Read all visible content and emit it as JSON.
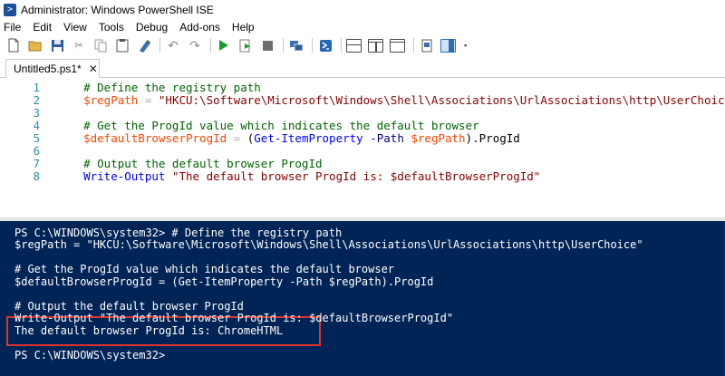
{
  "window": {
    "title": "Administrator: Windows PowerShell ISE"
  },
  "menu": [
    "File",
    "Edit",
    "View",
    "Tools",
    "Debug",
    "Add-ons",
    "Help"
  ],
  "toolbar": {
    "icons": [
      "new-icon",
      "open-icon",
      "save-icon",
      "cut-icon",
      "copy-icon",
      "paste-icon",
      "clear-console-icon",
      "undo-icon",
      "redo-icon",
      "run-icon",
      "run-selection-icon",
      "stop-icon",
      "new-remote-tab-icon",
      "powershell-icon",
      "show-script-top-icon",
      "show-script-right-icon",
      "show-script-maximized-icon",
      "show-command-icon",
      "show-command-addon-icon"
    ]
  },
  "tabs": [
    {
      "label": "Untitled5.ps1*",
      "close": "✕"
    }
  ],
  "editor": {
    "lines": [
      {
        "num": "1",
        "parts": [
          {
            "t": "    # Define the registry path",
            "c": "comment"
          }
        ]
      },
      {
        "num": "2",
        "parts": [
          {
            "t": "    $regPath",
            "c": "var"
          },
          {
            "t": " = ",
            "c": "op"
          },
          {
            "t": "\"HKCU:\\Software\\Microsoft\\Windows\\Shell\\Associations\\UrlAssociations\\http\\UserChoice\"",
            "c": "str"
          }
        ]
      },
      {
        "num": "3",
        "parts": [
          {
            "t": "",
            "c": "plain"
          }
        ]
      },
      {
        "num": "4",
        "parts": [
          {
            "t": "    # Get the ProgId value which indicates the default browser",
            "c": "comment"
          }
        ]
      },
      {
        "num": "5",
        "parts": [
          {
            "t": "    $defaultBrowserProgId",
            "c": "var"
          },
          {
            "t": " = ",
            "c": "op"
          },
          {
            "t": "(",
            "c": "plain"
          },
          {
            "t": "Get-ItemProperty",
            "c": "cmd"
          },
          {
            "t": " -Path ",
            "c": "param"
          },
          {
            "t": "$regPath",
            "c": "var"
          },
          {
            "t": ").ProgId",
            "c": "plain"
          }
        ]
      },
      {
        "num": "6",
        "parts": [
          {
            "t": "",
            "c": "plain"
          }
        ]
      },
      {
        "num": "7",
        "parts": [
          {
            "t": "    # Output the default browser ProgId",
            "c": "comment"
          }
        ]
      },
      {
        "num": "8",
        "parts": [
          {
            "t": "    Write-Output",
            "c": "cmd"
          },
          {
            "t": " ",
            "c": "plain"
          },
          {
            "t": "\"The default browser ProgId is: $defaultBrowserProgId\"",
            "c": "str"
          }
        ]
      }
    ]
  },
  "console": {
    "lines": [
      "PS C:\\WINDOWS\\system32> # Define the registry path",
      "$regPath = \"HKCU:\\Software\\Microsoft\\Windows\\Shell\\Associations\\UrlAssociations\\http\\UserChoice\"",
      "",
      "# Get the ProgId value which indicates the default browser",
      "$defaultBrowserProgId = (Get-ItemProperty -Path $regPath).ProgId",
      "",
      "# Output the default browser ProgId",
      "Write-Output \"The default browser ProgId is: $defaultBrowserProgId\"",
      "The default browser ProgId is: ChromeHTML",
      "",
      "PS C:\\WINDOWS\\system32>"
    ],
    "highlight_color": "#e0322d"
  },
  "colors": {
    "console_bg": "#012456",
    "comment": "#006400",
    "variable": "#ff4500",
    "string": "#8b0000",
    "command": "#0000ff",
    "line_number": "#2b91af"
  }
}
